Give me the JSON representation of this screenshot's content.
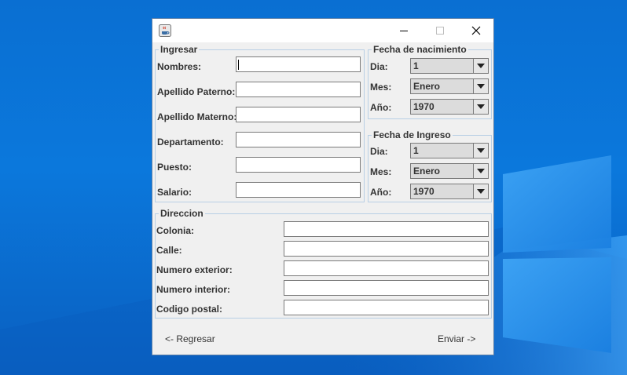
{
  "window": {
    "icon": "java-cup-icon",
    "controls": {
      "minimize": "minimize-icon",
      "maximize": "maximize-icon",
      "close": "close-icon"
    }
  },
  "ingresar": {
    "legend": "Ingresar",
    "fields": [
      {
        "label": "Nombres:",
        "value": ""
      },
      {
        "label": "Apellido Paterno:",
        "value": ""
      },
      {
        "label": "Apellido Materno:",
        "value": ""
      },
      {
        "label": "Departamento:",
        "value": ""
      },
      {
        "label": "Puesto:",
        "value": ""
      },
      {
        "label": "Salario:",
        "value": ""
      }
    ]
  },
  "fecha_nacimiento": {
    "legend": "Fecha de nacimiento",
    "dia_label": "Dia:",
    "dia_value": "1",
    "mes_label": "Mes:",
    "mes_value": "Enero",
    "anio_label": "Año:",
    "anio_value": "1970"
  },
  "fecha_ingreso": {
    "legend": "Fecha de Ingreso",
    "dia_label": "Dia:",
    "dia_value": "1",
    "mes_label": "Mes:",
    "mes_value": "Enero",
    "anio_label": "Año:",
    "anio_value": "1970"
  },
  "direccion": {
    "legend": "Direccion",
    "fields": [
      {
        "label": "Colonia:",
        "value": ""
      },
      {
        "label": "Calle:",
        "value": ""
      },
      {
        "label": "Numero exterior:",
        "value": ""
      },
      {
        "label": "Numero interior:",
        "value": ""
      },
      {
        "label": "Codigo postal:",
        "value": ""
      }
    ]
  },
  "actions": {
    "back_label": "<- Regresar",
    "send_label": "Enviar ->"
  },
  "colors": {
    "desktop_blue": "#0a6fd2",
    "window_bg": "#f0f0f0",
    "border_blue": "#b8cfe5"
  }
}
